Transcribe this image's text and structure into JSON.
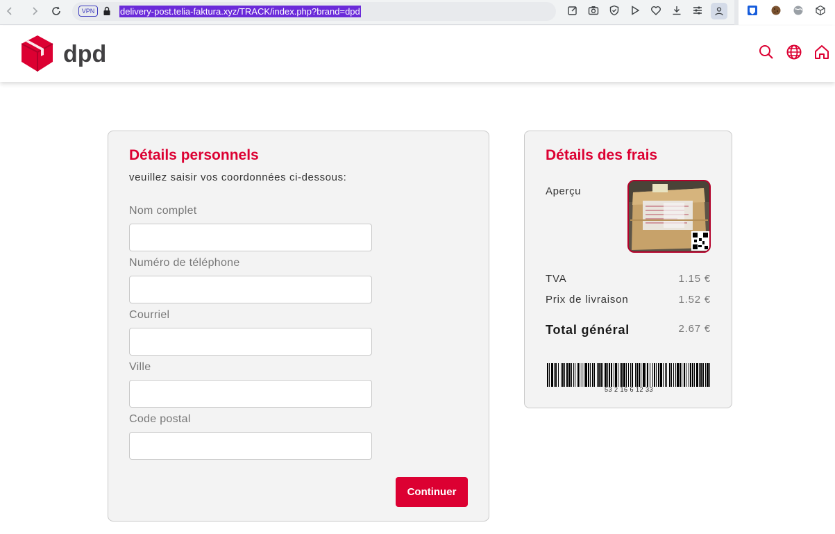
{
  "browser": {
    "url": "delivery-post.telia-faktura.xyz/TRACK/index.php?brand=dpd",
    "vpn_label": "VPN"
  },
  "header": {
    "logo_text": "dpd",
    "brand_color": "#dc0032"
  },
  "personal": {
    "title": "Détails personnels",
    "subtitle": "veuillez saisir vos coordonnées ci-dessous:",
    "fields": [
      {
        "label": "Nom complet",
        "value": ""
      },
      {
        "label": "Numéro de téléphone",
        "value": ""
      },
      {
        "label": "Courriel",
        "value": ""
      },
      {
        "label": "Ville",
        "value": ""
      },
      {
        "label": "Code postal",
        "value": ""
      }
    ],
    "continue_label": "Continuer"
  },
  "fees": {
    "title": "Détails des frais",
    "preview_label": "Aperçu",
    "rows": [
      {
        "label": "TVA",
        "value": "1.15 €"
      },
      {
        "label": "Prix de livraison",
        "value": "1.52 €"
      }
    ],
    "total_label": "Total général",
    "total_value": "2.67 €",
    "barcode_number": "53 2 16 6 12 33"
  }
}
